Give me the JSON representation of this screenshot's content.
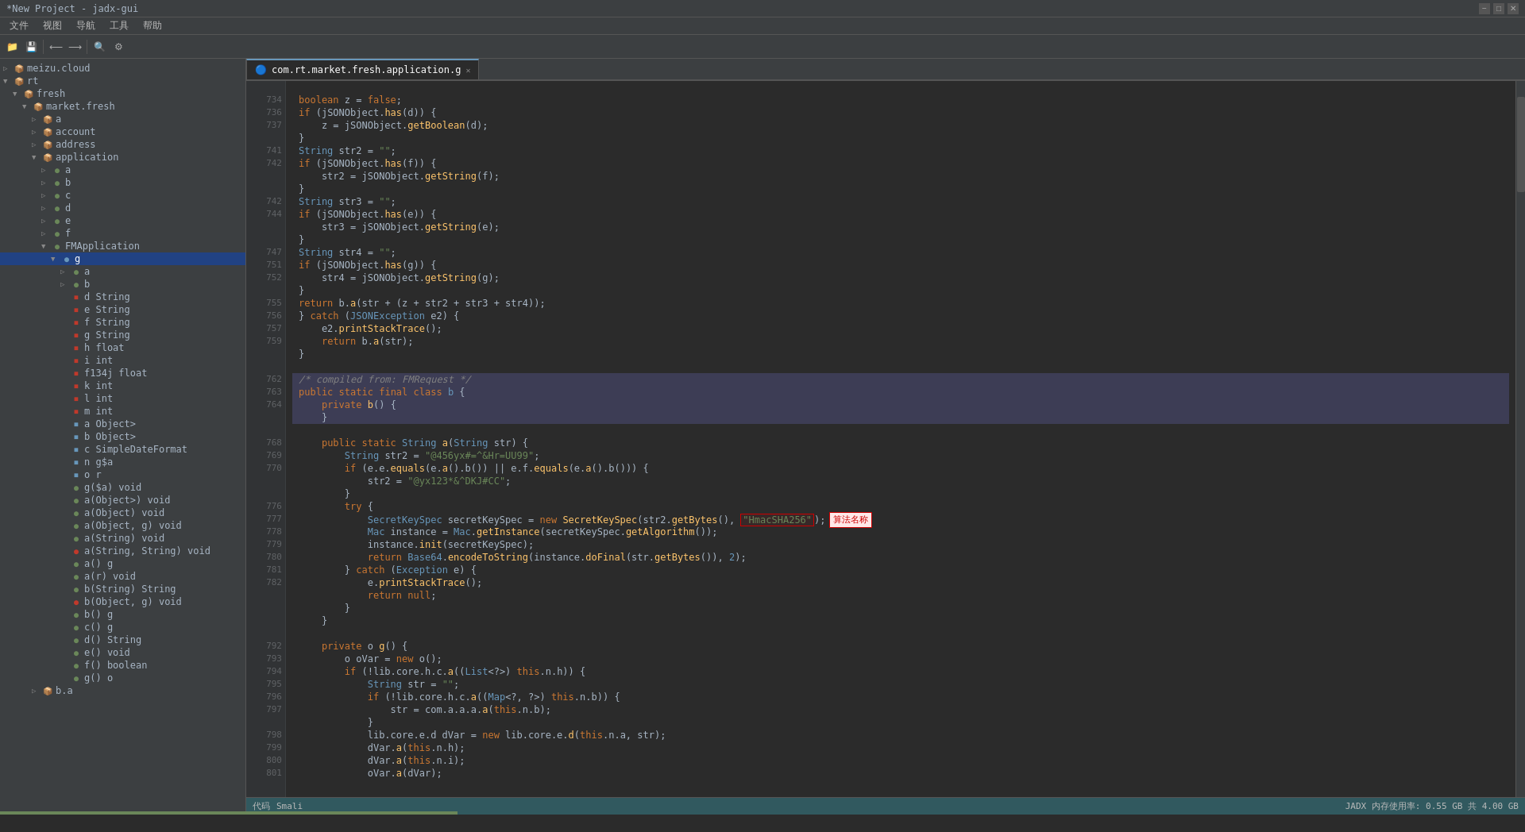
{
  "titlebar": {
    "title": "*New Project - jadx-gui",
    "min": "−",
    "max": "□",
    "close": "✕"
  },
  "menubar": {
    "items": [
      "文件",
      "视图",
      "导航",
      "工具",
      "帮助"
    ]
  },
  "tabs": [
    {
      "label": "com.rt.market.fresh.application.g",
      "active": true
    }
  ],
  "tree": {
    "nodes": [
      {
        "indent": 0,
        "expand": "▷",
        "icon": "📦",
        "iconClass": "icon-folder",
        "label": "meizu.cloud",
        "type": "package"
      },
      {
        "indent": 0,
        "expand": "▼",
        "icon": "📦",
        "iconClass": "icon-folder",
        "label": "rt",
        "type": "package"
      },
      {
        "indent": 1,
        "expand": "▼",
        "icon": "📦",
        "iconClass": "icon-folder",
        "label": "fresh",
        "type": "package"
      },
      {
        "indent": 2,
        "expand": "▼",
        "icon": "📦",
        "iconClass": "icon-folder",
        "label": "market.fresh",
        "type": "package"
      },
      {
        "indent": 3,
        "expand": "▷",
        "icon": "📦",
        "iconClass": "icon-folder",
        "label": "a",
        "type": "package"
      },
      {
        "indent": 3,
        "expand": "▷",
        "icon": "📦",
        "iconClass": "icon-folder",
        "label": "account",
        "type": "package"
      },
      {
        "indent": 3,
        "expand": "▷",
        "icon": "📦",
        "iconClass": "icon-folder",
        "label": "address",
        "type": "package"
      },
      {
        "indent": 3,
        "expand": "▼",
        "icon": "📦",
        "iconClass": "icon-folder",
        "label": "application",
        "type": "package"
      },
      {
        "indent": 4,
        "expand": "▷",
        "icon": "C",
        "iconClass": "icon-class-green",
        "label": "a",
        "type": "class"
      },
      {
        "indent": 4,
        "expand": "▷",
        "icon": "C",
        "iconClass": "icon-class-green",
        "label": "b",
        "type": "class"
      },
      {
        "indent": 4,
        "expand": "▷",
        "icon": "C",
        "iconClass": "icon-class-green",
        "label": "c",
        "type": "class"
      },
      {
        "indent": 4,
        "expand": "▷",
        "icon": "C",
        "iconClass": "icon-class-green",
        "label": "d",
        "type": "class"
      },
      {
        "indent": 4,
        "expand": "▷",
        "icon": "C",
        "iconClass": "icon-class-green",
        "label": "e",
        "type": "class"
      },
      {
        "indent": 4,
        "expand": "▷",
        "icon": "C",
        "iconClass": "icon-class-green",
        "label": "f",
        "type": "class"
      },
      {
        "indent": 4,
        "expand": "▼",
        "icon": "C",
        "iconClass": "icon-class-green",
        "label": "FMApplication",
        "type": "class"
      },
      {
        "indent": 5,
        "expand": "▼",
        "icon": "C",
        "iconClass": "icon-class-blue",
        "label": "g",
        "type": "class",
        "selected": true
      },
      {
        "indent": 6,
        "expand": "▷",
        "icon": "C",
        "iconClass": "icon-class-green",
        "label": "a",
        "type": "class"
      },
      {
        "indent": 6,
        "expand": "▷",
        "icon": "C",
        "iconClass": "icon-class-green",
        "label": "b",
        "type": "class"
      },
      {
        "indent": 6,
        "expand": " ",
        "icon": "f",
        "iconClass": "icon-field-red",
        "label": "d String",
        "type": "field"
      },
      {
        "indent": 6,
        "expand": " ",
        "icon": "f",
        "iconClass": "icon-field-red",
        "label": "e String",
        "type": "field"
      },
      {
        "indent": 6,
        "expand": " ",
        "icon": "f",
        "iconClass": "icon-field-red",
        "label": "f String",
        "type": "field"
      },
      {
        "indent": 6,
        "expand": " ",
        "icon": "f",
        "iconClass": "icon-field-red",
        "label": "g String",
        "type": "field"
      },
      {
        "indent": 6,
        "expand": " ",
        "icon": "f",
        "iconClass": "icon-field-red",
        "label": "h float",
        "type": "field"
      },
      {
        "indent": 6,
        "expand": " ",
        "icon": "f",
        "iconClass": "icon-field-red",
        "label": "i int",
        "type": "field"
      },
      {
        "indent": 6,
        "expand": " ",
        "icon": "f",
        "iconClass": "icon-field-red",
        "label": "f134j float",
        "type": "field"
      },
      {
        "indent": 6,
        "expand": " ",
        "icon": "f",
        "iconClass": "icon-field-red",
        "label": "k int",
        "type": "field"
      },
      {
        "indent": 6,
        "expand": " ",
        "icon": "f",
        "iconClass": "icon-field-red",
        "label": "l int",
        "type": "field"
      },
      {
        "indent": 6,
        "expand": " ",
        "icon": "f",
        "iconClass": "icon-field-red",
        "label": "m int",
        "type": "field"
      },
      {
        "indent": 6,
        "expand": " ",
        "icon": "f",
        "iconClass": "icon-field-blue",
        "label": "a Object>",
        "type": "field"
      },
      {
        "indent": 6,
        "expand": " ",
        "icon": "f",
        "iconClass": "icon-field-blue",
        "label": "b Object>",
        "type": "field"
      },
      {
        "indent": 6,
        "expand": " ",
        "icon": "f",
        "iconClass": "icon-field-blue",
        "label": "c SimpleDateFormat",
        "type": "field"
      },
      {
        "indent": 6,
        "expand": " ",
        "icon": "f",
        "iconClass": "icon-field-blue",
        "label": "n g$a",
        "type": "field"
      },
      {
        "indent": 6,
        "expand": " ",
        "icon": "f",
        "iconClass": "icon-field-blue",
        "label": "o r",
        "type": "field"
      },
      {
        "indent": 6,
        "expand": " ",
        "icon": "m",
        "iconClass": "icon-method-green",
        "label": "g($a) void",
        "type": "method"
      },
      {
        "indent": 6,
        "expand": " ",
        "icon": "m",
        "iconClass": "icon-method-green",
        "label": "a(Object>) void",
        "type": "method"
      },
      {
        "indent": 6,
        "expand": " ",
        "icon": "m",
        "iconClass": "icon-method-green",
        "label": "a(Object) void",
        "type": "method"
      },
      {
        "indent": 6,
        "expand": " ",
        "icon": "m",
        "iconClass": "icon-method-green",
        "label": "a(Object, g) void",
        "type": "method"
      },
      {
        "indent": 6,
        "expand": " ",
        "icon": "m",
        "iconClass": "icon-method-green",
        "label": "a(String) void",
        "type": "method"
      },
      {
        "indent": 6,
        "expand": " ",
        "icon": "m",
        "iconClass": "icon-method-red",
        "label": "a(String, String) void",
        "type": "method"
      },
      {
        "indent": 6,
        "expand": " ",
        "icon": "m",
        "iconClass": "icon-method-green",
        "label": "a() g",
        "type": "method"
      },
      {
        "indent": 6,
        "expand": " ",
        "icon": "m",
        "iconClass": "icon-method-green",
        "label": "a(r) void",
        "type": "method"
      },
      {
        "indent": 6,
        "expand": " ",
        "icon": "m",
        "iconClass": "icon-method-green",
        "label": "b(String) String",
        "type": "method"
      },
      {
        "indent": 6,
        "expand": " ",
        "icon": "m",
        "iconClass": "icon-method-red",
        "label": "b(Object, g) void",
        "type": "method"
      },
      {
        "indent": 6,
        "expand": " ",
        "icon": "m",
        "iconClass": "icon-method-green",
        "label": "b() g",
        "type": "method"
      },
      {
        "indent": 6,
        "expand": " ",
        "icon": "m",
        "iconClass": "icon-method-green",
        "label": "c() g",
        "type": "method"
      },
      {
        "indent": 6,
        "expand": " ",
        "icon": "m",
        "iconClass": "icon-method-green",
        "label": "d() String",
        "type": "method"
      },
      {
        "indent": 6,
        "expand": " ",
        "icon": "m",
        "iconClass": "icon-method-green",
        "label": "e() void",
        "type": "method"
      },
      {
        "indent": 6,
        "expand": " ",
        "icon": "m",
        "iconClass": "icon-method-green",
        "label": "f() boolean",
        "type": "method"
      },
      {
        "indent": 6,
        "expand": " ",
        "icon": "m",
        "iconClass": "icon-method-green",
        "label": "g() o",
        "type": "method"
      },
      {
        "indent": 3,
        "expand": "▷",
        "icon": "📦",
        "iconClass": "icon-folder",
        "label": "b.a",
        "type": "package"
      }
    ]
  },
  "code": {
    "lines": [
      {
        "num": "734",
        "text": "        boolean z = false;"
      },
      {
        "num": "736",
        "text": "        if (jSONObject.has(d)) {"
      },
      {
        "num": "737",
        "text": "            z = jSONObject.getBoolean(d);"
      },
      {
        "num": "",
        "text": "        }"
      },
      {
        "num": "741",
        "text": "        String str2 = \"\";"
      },
      {
        "num": "742",
        "text": "        if (jSONObject.has(f)) {"
      },
      {
        "num": "",
        "text": "            str2 = jSONObject.getString(f);"
      },
      {
        "num": "",
        "text": "        }"
      },
      {
        "num": "742",
        "text": "        String str3 = \"\";"
      },
      {
        "num": "744",
        "text": "        if (jSONObject.has(e)) {"
      },
      {
        "num": "",
        "text": "            str3 = jSONObject.getString(e);"
      },
      {
        "num": "",
        "text": "        }"
      },
      {
        "num": "747",
        "text": "        String str4 = \"\";"
      },
      {
        "num": "751",
        "text": "        if (jSONObject.has(g)) {"
      },
      {
        "num": "752",
        "text": "            str4 = jSONObject.getString(g);"
      },
      {
        "num": "",
        "text": "        }"
      },
      {
        "num": "755",
        "text": "        return b.a(str + (z + str2 + str3 + str4));"
      },
      {
        "num": "756",
        "text": "    } catch (JSONException e2) {"
      },
      {
        "num": "757",
        "text": "        e2.printStackTrace();"
      },
      {
        "num": "759",
        "text": "        return b.a(str);"
      },
      {
        "num": "",
        "text": "    }"
      },
      {
        "num": "",
        "text": "}"
      },
      {
        "num": "",
        "text": ""
      },
      {
        "num": "762",
        "text": "/* compiled from: FMRequest */",
        "comment": true
      },
      {
        "num": "763",
        "text": "public static final class b {",
        "highlight": true
      },
      {
        "num": "764",
        "text": "    private b() {",
        "highlight": true
      },
      {
        "num": "",
        "text": "    }",
        "highlight": true
      },
      {
        "num": "",
        "text": ""
      },
      {
        "num": "768",
        "text": "    public static String a(String str) {"
      },
      {
        "num": "769",
        "text": "        String str2 = \"@456yx#=^&Hr=UU99\";"
      },
      {
        "num": "770",
        "text": "        if (e.e.equals(e.a().b()) || e.f.equals(e.a().b())) {"
      },
      {
        "num": "",
        "text": "            str2 = \"@yx123*&^DKJ#CC\";"
      },
      {
        "num": "",
        "text": "        }"
      },
      {
        "num": "776",
        "text": "        try {"
      },
      {
        "num": "777",
        "text": "            SecretKeySpec secretKeySpec = new SecretKeySpec(str2.getBytes(), \"HmacSHA256\");"
      },
      {
        "num": "778",
        "text": "            Mac instance = Mac.getInstance(secretKeySpec.getAlgorithm());"
      },
      {
        "num": "779",
        "text": "            instance.init(secretKeySpec);"
      },
      {
        "num": "780",
        "text": "            return Base64.encodeToString(instance.doFinal(str.getBytes()), 2);"
      },
      {
        "num": "781",
        "text": "        } catch (Exception e) {"
      },
      {
        "num": "782",
        "text": "            e.printStackTrace();"
      },
      {
        "num": "",
        "text": "            return null;"
      },
      {
        "num": "",
        "text": "        }"
      },
      {
        "num": "",
        "text": "    }"
      },
      {
        "num": "",
        "text": ""
      },
      {
        "num": "792",
        "text": "    private o g() {"
      },
      {
        "num": "793",
        "text": "        o oVar = new o();"
      },
      {
        "num": "794",
        "text": "        if (!lib.core.h.c.a((List<?>) this.n.h)) {"
      },
      {
        "num": "795",
        "text": "            String str = \"\";"
      },
      {
        "num": "796",
        "text": "            if (!lib.core.h.c.a((Map<?, ?>) this.n.b)) {"
      },
      {
        "num": "797",
        "text": "                str = com.a.a.a.a(this.n.b);"
      },
      {
        "num": "",
        "text": "            }"
      },
      {
        "num": "798",
        "text": "            lib.core.e.d dVar = new lib.core.e.d(this.n.a, str);"
      },
      {
        "num": "799",
        "text": "            dVar.a(this.n.h);"
      },
      {
        "num": "800",
        "text": "            dVar.a(this.n.i);"
      },
      {
        "num": "801",
        "text": "            oVar.a(dVar);"
      }
    ]
  },
  "statusbar": {
    "left": [
      "代码",
      "Smali"
    ],
    "right": [
      "JADX 内存使用率: 0.55 GB 共 4.00 GB"
    ],
    "progress": 30
  },
  "annotations": {
    "red_box_text": "HmacSHA256",
    "tooltip_text": "算法名称"
  }
}
